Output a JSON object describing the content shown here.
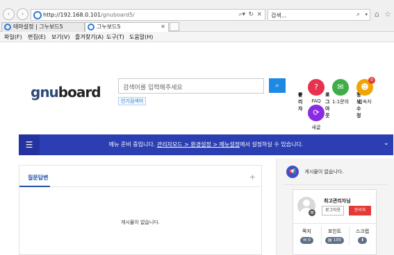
{
  "browser": {
    "url_host": "http://192.168.0.101",
    "url_path": "/gnuboard5/",
    "search_placeholder": "검색...",
    "refresh_glyph": "↻",
    "stop_glyph": "×",
    "dropdown_glyph": "▾",
    "tabs": [
      {
        "title": "테마설정 | 그누보드5"
      },
      {
        "title": "그누보드5"
      }
    ],
    "menu": [
      "파일(F)",
      "편집(E)",
      "보기(V)",
      "즐겨찾기(A)",
      "도구(T)",
      "도움말(H)"
    ]
  },
  "top_nav": {
    "admin": "관리자",
    "logout": "로그아웃",
    "edit_profile": "정보수정"
  },
  "logo": {
    "part1": "gnu",
    "part2": "board"
  },
  "search": {
    "placeholder": "검색어를 입력해주세요",
    "popular_label": "인기검색어"
  },
  "quick_menu": [
    {
      "label": "FAQ",
      "icon": "question-icon",
      "color": "#e8304f",
      "glyph": "?"
    },
    {
      "label": "1:1문의",
      "icon": "chat-icon",
      "color": "#3fae49",
      "glyph": "✉"
    },
    {
      "label": "접속자",
      "icon": "users-icon",
      "color": "#f0a500",
      "glyph": "☻",
      "badge": "0"
    },
    {
      "label": "새글",
      "icon": "refresh-icon",
      "color": "#8a2be2",
      "glyph": "⟳"
    }
  ],
  "nav_bar": {
    "color": "#2b3fb3",
    "notice_prefix": "메뉴 준비 중입니다. ",
    "notice_link": "관리자모드 > 환경설정 > 메뉴설정",
    "notice_suffix": "에서 설정하실 수 있습니다."
  },
  "board": {
    "title": "질문답변",
    "plus": "+",
    "empty": "게시물이 없습니다."
  },
  "side_notice": {
    "text": "게시물이 없습니다."
  },
  "profile": {
    "name": "최고관리자님",
    "logout_label": "로그아웃",
    "admin_label": "관리자",
    "stats": [
      {
        "label": "쪽지",
        "value": "0"
      },
      {
        "label": "포인트",
        "value": "100"
      },
      {
        "label": "스크랩",
        "value": ""
      }
    ]
  },
  "colors": {
    "accent": "#1e88e5",
    "danger": "#e53935",
    "nav": "#2b3fb3"
  }
}
